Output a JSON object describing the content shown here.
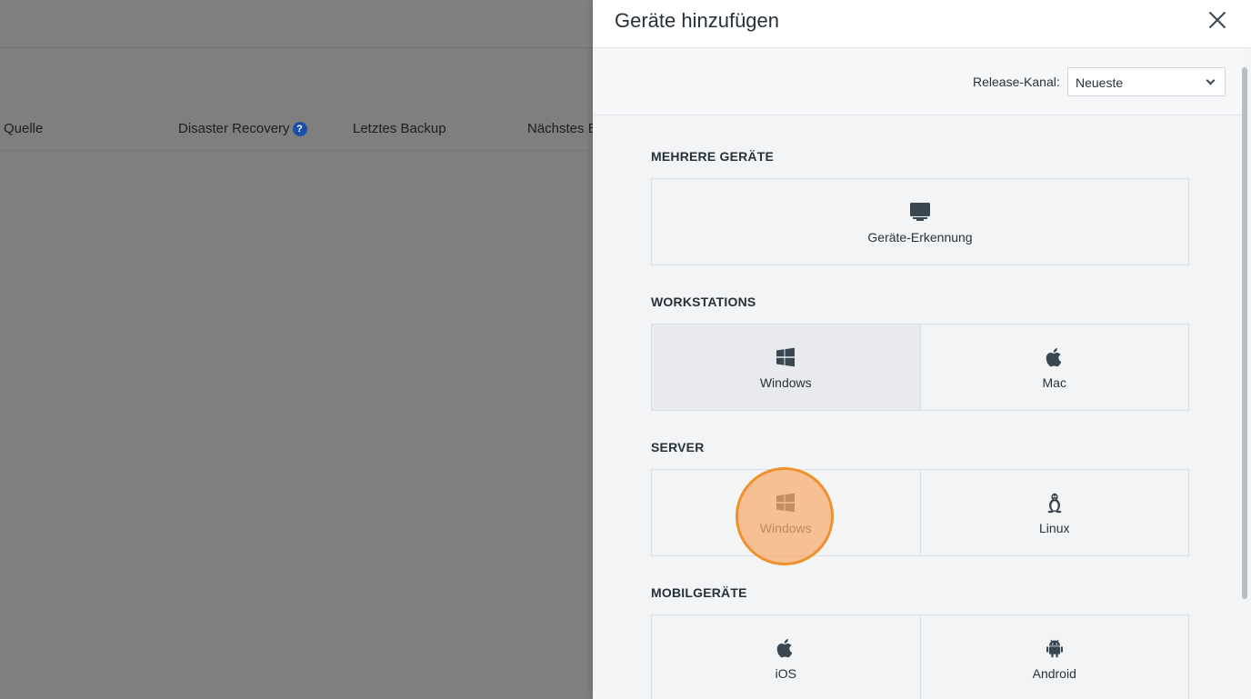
{
  "background": {
    "columns": [
      "Quelle",
      "Disaster Recovery",
      "Letztes Backup",
      "Nächstes B"
    ],
    "help_icon": "question-icon"
  },
  "drawer": {
    "title": "Geräte hinzufügen",
    "close_icon": "close-icon",
    "release": {
      "label": "Release-Kanal:",
      "value": "Neueste"
    },
    "sections": [
      {
        "title": "MEHRERE GERÄTE",
        "tiles": [
          {
            "label": "Geräte-Erkennung",
            "icon": "monitor-icon"
          }
        ]
      },
      {
        "title": "WORKSTATIONS",
        "tiles": [
          {
            "label": "Windows",
            "icon": "windows-icon"
          },
          {
            "label": "Mac",
            "icon": "apple-icon"
          }
        ]
      },
      {
        "title": "SERVER",
        "tiles": [
          {
            "label": "Windows",
            "icon": "windows-icon"
          },
          {
            "label": "Linux",
            "icon": "linux-icon"
          }
        ]
      },
      {
        "title": "MOBILGERÄTE",
        "tiles": [
          {
            "label": "iOS",
            "icon": "apple-icon"
          },
          {
            "label": "Android",
            "icon": "android-icon"
          }
        ]
      }
    ]
  },
  "colors": {
    "overlay": "#7f7f7f",
    "highlight": "#f0912f",
    "accent": "#1c4ea8"
  }
}
